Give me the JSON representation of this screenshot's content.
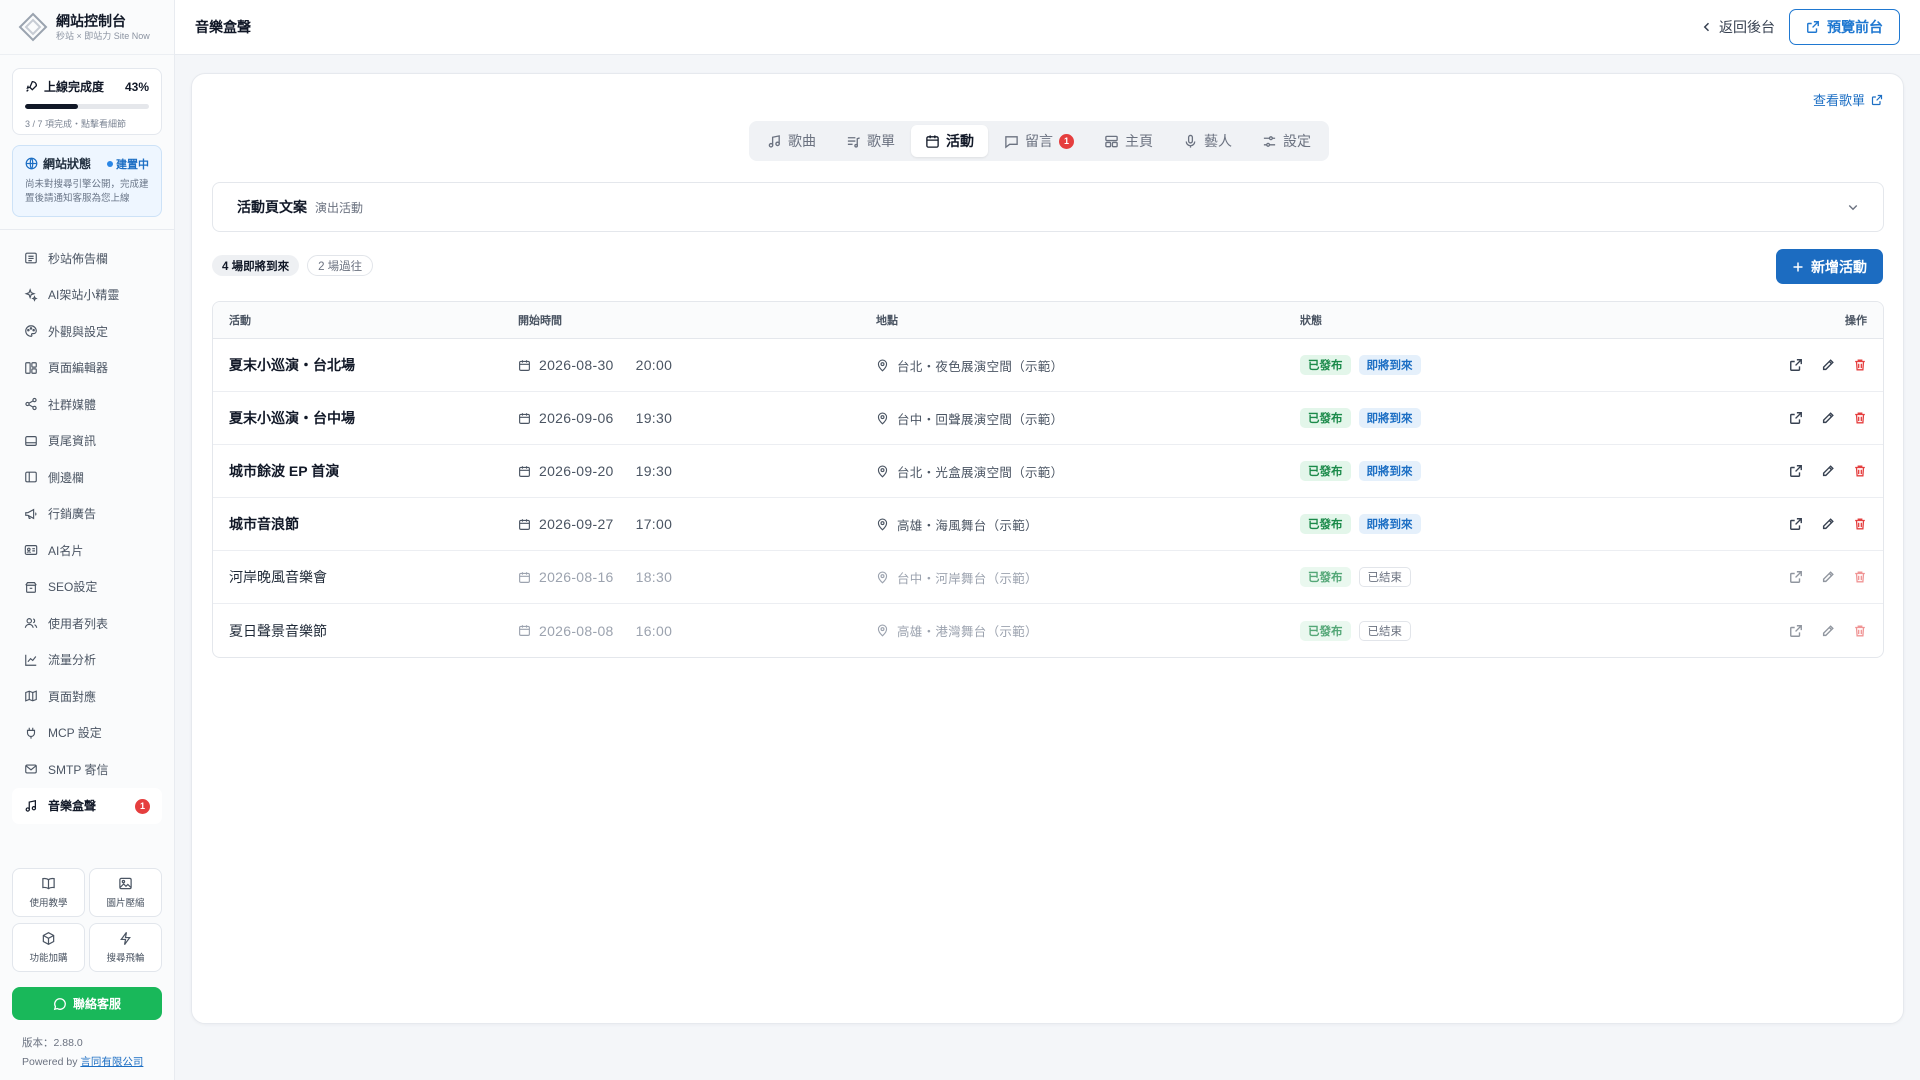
{
  "brand": {
    "title": "網站控制台",
    "subtitle": "秒站 × 即站力 Site Now"
  },
  "progress": {
    "label": "上線完成度",
    "percent_text": "43%",
    "fraction": 0.43,
    "sub": "3 / 7 項完成・點擊看細節"
  },
  "site_status": {
    "label": "網站狀態",
    "badge": "建置中",
    "text": "尚未對搜尋引擎公開，完成建置後請通知客服為您上線"
  },
  "nav": [
    {
      "label": "秒站佈告欄",
      "icon": "newspaper-icon"
    },
    {
      "label": "AI架站小精靈",
      "icon": "sparkles-icon"
    },
    {
      "label": "外觀與設定",
      "icon": "palette-icon"
    },
    {
      "label": "頁面編輯器",
      "icon": "layout-icon"
    },
    {
      "label": "社群媒體",
      "icon": "share-icon"
    },
    {
      "label": "頁尾資訊",
      "icon": "footer-icon"
    },
    {
      "label": "側邊欄",
      "icon": "sidebar-icon"
    },
    {
      "label": "行銷廣告",
      "icon": "megaphone-icon"
    },
    {
      "label": "AI名片",
      "icon": "id-card-icon"
    },
    {
      "label": "SEO設定",
      "icon": "seo-icon"
    },
    {
      "label": "使用者列表",
      "icon": "users-icon"
    },
    {
      "label": "流量分析",
      "icon": "chart-icon"
    },
    {
      "label": "頁面對應",
      "icon": "map-icon"
    },
    {
      "label": "MCP 設定",
      "icon": "plug-icon"
    },
    {
      "label": "SMTP 寄信",
      "icon": "mail-icon"
    },
    {
      "label": "音樂盒聲",
      "icon": "music-icon",
      "badge": "1",
      "active": true
    }
  ],
  "tools": [
    {
      "label": "使用教學",
      "icon": "book-icon"
    },
    {
      "label": "圖片壓縮",
      "icon": "image-icon"
    },
    {
      "label": "功能加購",
      "icon": "package-icon"
    },
    {
      "label": "搜尋飛輪",
      "icon": "bolt-icon"
    }
  ],
  "contact_label": "聯絡客服",
  "version": {
    "prefix": "版本：",
    "number": "2.88.0",
    "powered_prefix": "Powered by ",
    "company": "言同有限公司"
  },
  "topbar": {
    "title": "音樂盒聲",
    "back_label": "返回後台",
    "preview_label": "預覽前台"
  },
  "view_list_label": "查看歌單",
  "tabs": [
    {
      "label": "歌曲",
      "icon": "music-note-icon"
    },
    {
      "label": "歌單",
      "icon": "playlist-icon"
    },
    {
      "label": "活動",
      "icon": "calendar-icon",
      "active": true
    },
    {
      "label": "留言",
      "icon": "message-icon",
      "badge": "1"
    },
    {
      "label": "主頁",
      "icon": "home-layout-icon"
    },
    {
      "label": "藝人",
      "icon": "mic-icon"
    },
    {
      "label": "設定",
      "icon": "sliders-icon"
    }
  ],
  "copy_section": {
    "title": "活動頁文案",
    "subtitle": "演出活動"
  },
  "filters": {
    "upcoming": "4 場即將到來",
    "past": "2 場過往"
  },
  "add_label": "新增活動",
  "table": {
    "headers": {
      "event": "活動",
      "start": "開始時間",
      "place": "地點",
      "status": "狀態",
      "actions": "操作"
    },
    "rows": [
      {
        "name": "夏末小巡演・台北場",
        "date": "2026-08-30",
        "time": "20:00",
        "place": "台北・夜色展演空間（示範）",
        "published": "已發布",
        "state": "即將到來",
        "past": false
      },
      {
        "name": "夏末小巡演・台中場",
        "date": "2026-09-06",
        "time": "19:30",
        "place": "台中・回聲展演空間（示範）",
        "published": "已發布",
        "state": "即將到來",
        "past": false
      },
      {
        "name": "城市餘波 EP 首演",
        "date": "2026-09-20",
        "time": "19:30",
        "place": "台北・光盒展演空間（示範）",
        "published": "已發布",
        "state": "即將到來",
        "past": false
      },
      {
        "name": "城市音浪節",
        "date": "2026-09-27",
        "time": "17:00",
        "place": "高雄・海風舞台（示範）",
        "published": "已發布",
        "state": "即將到來",
        "past": false
      },
      {
        "name": "河岸晚風音樂會",
        "date": "2026-08-16",
        "time": "18:30",
        "place": "台中・河岸舞台（示範）",
        "published": "已發布",
        "state": "已結束",
        "past": true
      },
      {
        "name": "夏日聲景音樂節",
        "date": "2026-08-08",
        "time": "16:00",
        "place": "高雄・港灣舞台（示範）",
        "published": "已發布",
        "state": "已結束",
        "past": true
      }
    ]
  },
  "colors": {
    "accent": "#1c6cc1",
    "success": "#19b85a",
    "danger": "#e53e3e"
  }
}
